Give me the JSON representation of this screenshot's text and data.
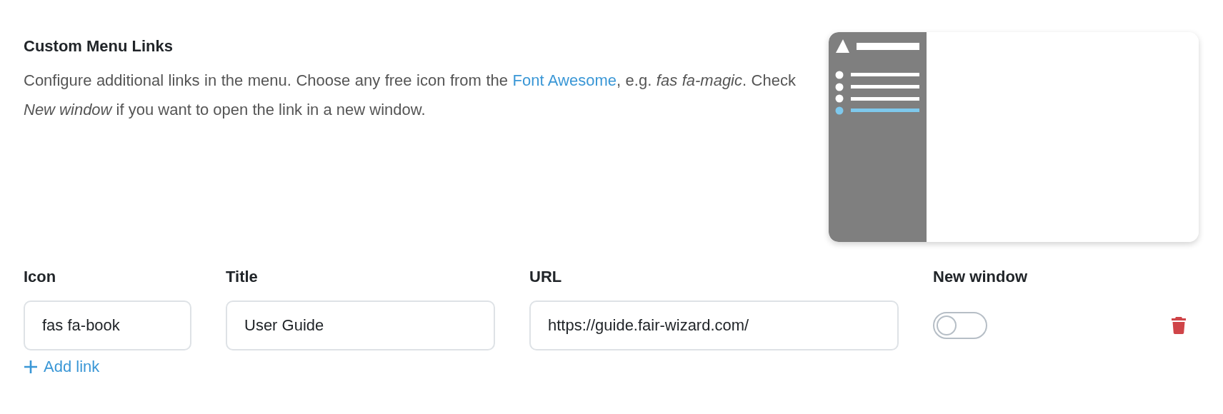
{
  "section": {
    "title": "Custom Menu Links",
    "description": {
      "before": "Configure additional links in the menu. Choose any free icon from the ",
      "link": "Font Awesome",
      "after": ", e.g. *fas fa-magic*. Check *New window* if you want to open the link in a new window."
    }
  },
  "columns": [
    "Icon",
    "Title",
    "URL",
    "New window"
  ],
  "links": [
    {
      "icon": "fas fa-book",
      "title": "User Guide",
      "url": "https://guide.fair-wizard.com/",
      "new_window": false
    }
  ],
  "add_button": "Add link"
}
